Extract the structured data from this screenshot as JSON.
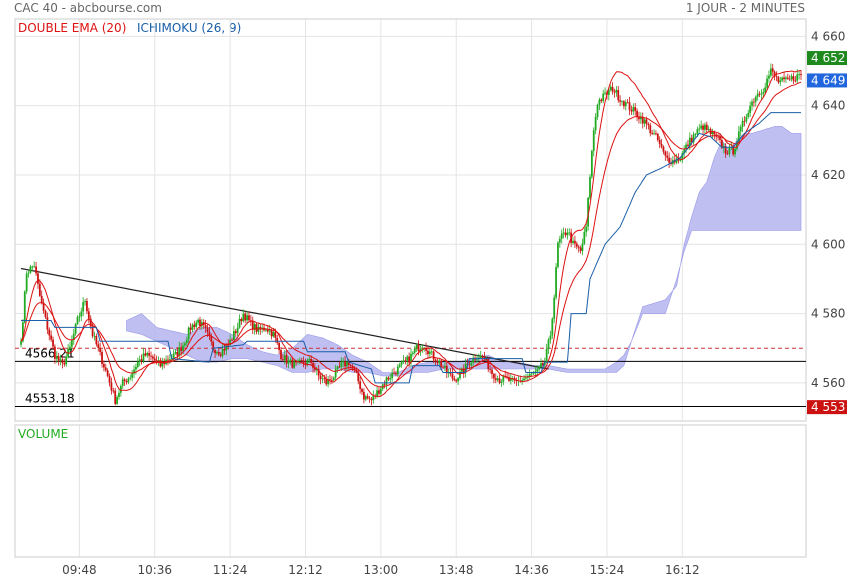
{
  "header": {
    "title": "CAC 40 - abcbourse.com",
    "period": "1 JOUR - 2 MINUTES"
  },
  "legend": {
    "ema_label": "DOUBLE EMA (20)",
    "ichimoku_label": "ICHIMOKU (26, 9)",
    "volume_label": "VOLUME"
  },
  "colors": {
    "up": "#22aa22",
    "down": "#cc1111",
    "ema": "#dd1111",
    "kijun": "#1a5fa8",
    "cloud": "#b4b4f0",
    "grid": "#e4e4e4",
    "badge_high": "#1e8a1e",
    "badge_last": "#2266dd",
    "badge_low": "#cc1111"
  },
  "chart_data": {
    "type": "candlestick",
    "ylim": [
      4549,
      4665
    ],
    "y_ticks": [
      "4 560",
      "4 580",
      "4 600",
      "4 620",
      "4 640",
      "4 660"
    ],
    "y_tick_values": [
      4560,
      4580,
      4600,
      4620,
      4640,
      4660
    ],
    "x_ticks": [
      "09:48",
      "10:36",
      "11:24",
      "12:12",
      "13:00",
      "13:48",
      "14:36",
      "15:24",
      "16:12"
    ],
    "price_badges": [
      {
        "label": "4 652",
        "value": 4652,
        "kind": "high"
      },
      {
        "label": "4 649",
        "value": 4649,
        "kind": "last"
      },
      {
        "label": "4 553",
        "value": 4553,
        "kind": "low"
      }
    ],
    "level_lines": [
      {
        "label": "4566.21",
        "value": 4566.21
      },
      {
        "label": "4553.18",
        "value": 4553.18
      }
    ],
    "reference_line": 4570,
    "trendline": {
      "start": [
        0,
        4593
      ],
      "end": [
        280,
        4564
      ]
    },
    "close_key_points": [
      [
        0,
        4572
      ],
      [
        3,
        4592
      ],
      [
        7,
        4594
      ],
      [
        10,
        4585
      ],
      [
        14,
        4576
      ],
      [
        18,
        4568
      ],
      [
        22,
        4565
      ],
      [
        26,
        4570
      ],
      [
        30,
        4578
      ],
      [
        34,
        4584
      ],
      [
        38,
        4574
      ],
      [
        42,
        4568
      ],
      [
        46,
        4562
      ],
      [
        50,
        4555
      ],
      [
        54,
        4560
      ],
      [
        58,
        4562
      ],
      [
        62,
        4566
      ],
      [
        66,
        4568
      ],
      [
        70,
        4567
      ],
      [
        74,
        4565
      ],
      [
        78,
        4567
      ],
      [
        82,
        4568
      ],
      [
        86,
        4571
      ],
      [
        90,
        4576
      ],
      [
        94,
        4578
      ],
      [
        98,
        4575
      ],
      [
        102,
        4570
      ],
      [
        106,
        4569
      ],
      [
        110,
        4571
      ],
      [
        114,
        4575
      ],
      [
        118,
        4580
      ],
      [
        122,
        4577
      ],
      [
        126,
        4575
      ],
      [
        130,
        4576
      ],
      [
        134,
        4574
      ],
      [
        138,
        4568
      ],
      [
        142,
        4566
      ],
      [
        146,
        4565
      ],
      [
        150,
        4566
      ],
      [
        154,
        4566
      ],
      [
        158,
        4562
      ],
      [
        162,
        4560
      ],
      [
        166,
        4562
      ],
      [
        170,
        4565
      ],
      [
        174,
        4566
      ],
      [
        178,
        4562
      ],
      [
        182,
        4556
      ],
      [
        186,
        4555
      ],
      [
        190,
        4558
      ],
      [
        194,
        4561
      ],
      [
        198,
        4563
      ],
      [
        202,
        4565
      ],
      [
        206,
        4567
      ],
      [
        210,
        4570
      ],
      [
        214,
        4571
      ],
      [
        218,
        4568
      ],
      [
        222,
        4566
      ],
      [
        226,
        4563
      ],
      [
        230,
        4561
      ],
      [
        234,
        4563
      ],
      [
        238,
        4566
      ],
      [
        242,
        4568
      ],
      [
        246,
        4567
      ],
      [
        250,
        4563
      ],
      [
        254,
        4561
      ],
      [
        258,
        4561
      ],
      [
        262,
        4560
      ],
      [
        266,
        4561
      ],
      [
        270,
        4562
      ],
      [
        274,
        4563
      ],
      [
        278,
        4566
      ],
      [
        281,
        4574
      ],
      [
        283,
        4585
      ],
      [
        285,
        4600
      ],
      [
        287,
        4602
      ],
      [
        290,
        4604
      ],
      [
        293,
        4600
      ],
      [
        297,
        4598
      ],
      [
        300,
        4605
      ],
      [
        302,
        4620
      ],
      [
        304,
        4633
      ],
      [
        306,
        4641
      ],
      [
        310,
        4643
      ],
      [
        314,
        4645
      ],
      [
        318,
        4642
      ],
      [
        322,
        4640
      ],
      [
        326,
        4638
      ],
      [
        330,
        4636
      ],
      [
        334,
        4633
      ],
      [
        338,
        4630
      ],
      [
        342,
        4625
      ],
      [
        346,
        4624
      ],
      [
        350,
        4625
      ],
      [
        354,
        4629
      ],
      [
        358,
        4632
      ],
      [
        362,
        4634
      ],
      [
        366,
        4632
      ],
      [
        370,
        4630
      ],
      [
        374,
        4627
      ],
      [
        378,
        4627
      ],
      [
        382,
        4633
      ],
      [
        386,
        4639
      ],
      [
        390,
        4643
      ],
      [
        394,
        4645
      ],
      [
        398,
        4650
      ],
      [
        402,
        4647
      ],
      [
        406,
        4647
      ],
      [
        410,
        4648
      ],
      [
        414,
        4649
      ]
    ],
    "ichimoku": {
      "kijun_key_points": [
        [
          0,
          4578
        ],
        [
          4,
          4578
        ],
        [
          16,
          4578
        ],
        [
          18,
          4576
        ],
        [
          40,
          4576
        ],
        [
          42,
          4572
        ],
        [
          78,
          4572
        ],
        [
          80,
          4567
        ],
        [
          100,
          4566
        ],
        [
          102,
          4570
        ],
        [
          118,
          4571
        ],
        [
          120,
          4572
        ],
        [
          150,
          4572
        ],
        [
          152,
          4569
        ],
        [
          172,
          4569
        ],
        [
          174,
          4566
        ],
        [
          186,
          4564
        ],
        [
          188,
          4560
        ],
        [
          206,
          4560
        ],
        [
          208,
          4565
        ],
        [
          222,
          4565
        ],
        [
          224,
          4563
        ],
        [
          236,
          4563
        ],
        [
          238,
          4567
        ],
        [
          266,
          4567
        ],
        [
          268,
          4563
        ],
        [
          276,
          4563
        ],
        [
          278,
          4566
        ],
        [
          290,
          4566
        ],
        [
          292,
          4580
        ],
        [
          300,
          4580
        ],
        [
          302,
          4590
        ],
        [
          310,
          4600
        ],
        [
          318,
          4605
        ],
        [
          326,
          4615
        ],
        [
          332,
          4620
        ],
        [
          340,
          4622
        ],
        [
          350,
          4625
        ],
        [
          360,
          4632
        ],
        [
          366,
          4631
        ],
        [
          372,
          4628
        ],
        [
          378,
          4628
        ],
        [
          384,
          4632
        ],
        [
          392,
          4635
        ],
        [
          398,
          4638
        ],
        [
          404,
          4638
        ],
        [
          414,
          4638
        ]
      ],
      "span_a_key_points": [
        [
          56,
          4578
        ],
        [
          64,
          4580
        ],
        [
          72,
          4576
        ],
        [
          80,
          4575
        ],
        [
          88,
          4574
        ],
        [
          96,
          4576
        ],
        [
          104,
          4576
        ],
        [
          112,
          4574
        ],
        [
          120,
          4571
        ],
        [
          128,
          4569
        ],
        [
          136,
          4568
        ],
        [
          144,
          4570
        ],
        [
          152,
          4574
        ],
        [
          160,
          4573
        ],
        [
          168,
          4571
        ],
        [
          176,
          4568
        ],
        [
          184,
          4566
        ],
        [
          192,
          4563
        ],
        [
          200,
          4563
        ],
        [
          208,
          4565
        ],
        [
          216,
          4566
        ],
        [
          224,
          4566
        ],
        [
          232,
          4566
        ],
        [
          240,
          4567
        ],
        [
          248,
          4568
        ],
        [
          256,
          4566
        ],
        [
          264,
          4566
        ],
        [
          272,
          4565
        ],
        [
          280,
          4565
        ],
        [
          290,
          4564
        ],
        [
          300,
          4564
        ],
        [
          310,
          4564
        ],
        [
          316,
          4566
        ],
        [
          320,
          4568
        ],
        [
          324,
          4572
        ],
        [
          330,
          4582
        ],
        [
          336,
          4583
        ],
        [
          342,
          4584
        ],
        [
          348,
          4588
        ],
        [
          352,
          4600
        ],
        [
          356,
          4608
        ],
        [
          360,
          4615
        ],
        [
          364,
          4618
        ],
        [
          368,
          4625
        ],
        [
          372,
          4630
        ],
        [
          376,
          4627
        ],
        [
          380,
          4630
        ],
        [
          384,
          4632
        ],
        [
          388,
          4632
        ],
        [
          394,
          4633
        ],
        [
          400,
          4634
        ],
        [
          404,
          4634
        ],
        [
          409,
          4632
        ],
        [
          414,
          4632
        ]
      ],
      "span_b_key_points": [
        [
          56,
          4575
        ],
        [
          64,
          4574
        ],
        [
          72,
          4572
        ],
        [
          80,
          4570
        ],
        [
          88,
          4568
        ],
        [
          96,
          4566
        ],
        [
          104,
          4566
        ],
        [
          112,
          4567
        ],
        [
          120,
          4567
        ],
        [
          128,
          4566
        ],
        [
          136,
          4565
        ],
        [
          144,
          4563
        ],
        [
          152,
          4563
        ],
        [
          160,
          4564
        ],
        [
          168,
          4564
        ],
        [
          176,
          4563
        ],
        [
          184,
          4563
        ],
        [
          192,
          4562
        ],
        [
          200,
          4562
        ],
        [
          208,
          4563
        ],
        [
          216,
          4563
        ],
        [
          224,
          4564
        ],
        [
          232,
          4564
        ],
        [
          240,
          4564
        ],
        [
          248,
          4564
        ],
        [
          256,
          4564
        ],
        [
          264,
          4564
        ],
        [
          272,
          4564
        ],
        [
          280,
          4564
        ],
        [
          290,
          4563
        ],
        [
          300,
          4563
        ],
        [
          310,
          4563
        ],
        [
          316,
          4563
        ],
        [
          320,
          4565
        ],
        [
          324,
          4572
        ],
        [
          330,
          4580
        ],
        [
          336,
          4580
        ],
        [
          342,
          4580
        ],
        [
          348,
          4590
        ],
        [
          352,
          4598
        ],
        [
          356,
          4604
        ],
        [
          360,
          4604
        ],
        [
          364,
          4604
        ],
        [
          368,
          4604
        ],
        [
          372,
          4604
        ],
        [
          376,
          4604
        ],
        [
          380,
          4604
        ],
        [
          384,
          4604
        ],
        [
          388,
          4604
        ],
        [
          394,
          4604
        ],
        [
          400,
          4604
        ],
        [
          404,
          4604
        ],
        [
          409,
          4604
        ],
        [
          414,
          4604
        ]
      ]
    }
  }
}
